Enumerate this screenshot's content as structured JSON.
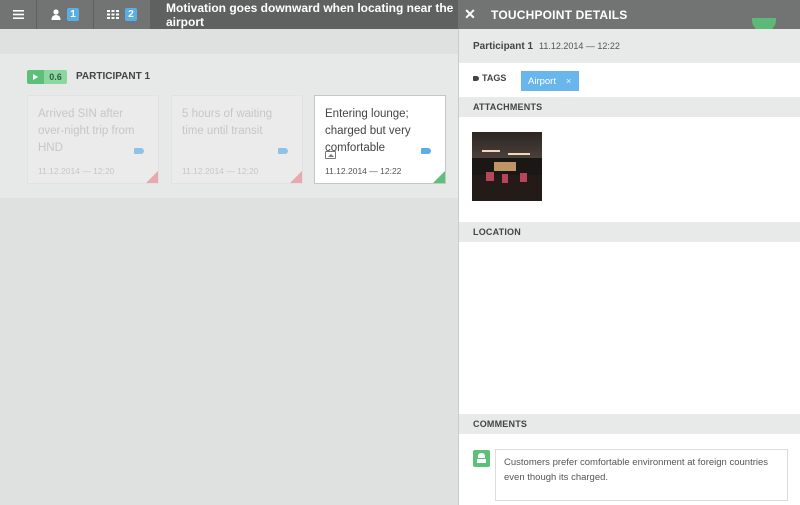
{
  "topbar": {
    "menu_icon": "hamburger-icon",
    "participants_icon": "user-icon",
    "participants_count": "1",
    "touchpoints_icon": "grid-icon",
    "touchpoints_count": "2",
    "title": "Motivation goes downward when locating near the airport",
    "close_label": "✕",
    "panel_title": "TOUCHPOINT DETAILS"
  },
  "lane": {
    "score": "0.6",
    "participant_label": "PARTICIPANT 1",
    "cards": [
      {
        "text": "Arrived SIN after over-night trip from HND",
        "date": "11.12.2014 — 12:20",
        "sentiment": "negative"
      },
      {
        "text": "5 hours of waiting time until transit",
        "date": "11.12.2014 — 12:20",
        "sentiment": "negative"
      },
      {
        "text": "Entering lounge; charged but very comfortable",
        "date": "11.12.2014 — 12:22",
        "sentiment": "positive",
        "has_image": true
      }
    ]
  },
  "panel": {
    "participant": "Participant 1",
    "datetime": "11.12.2014 — 12:22",
    "tags_label": "TAGS",
    "tags": [
      {
        "label": "Airport",
        "remove": "×"
      }
    ],
    "attachments_label": "ATTACHMENTS",
    "location_label": "LOCATION",
    "comments_label": "COMMENTS",
    "comment_text": "Customers prefer comfortable environment at foreign countries even though its charged."
  },
  "colors": {
    "accent_blue": "#5aaee6",
    "positive_green": "#5cc07a",
    "negative_red": "#e8a8ae",
    "topbar": "#727473"
  }
}
